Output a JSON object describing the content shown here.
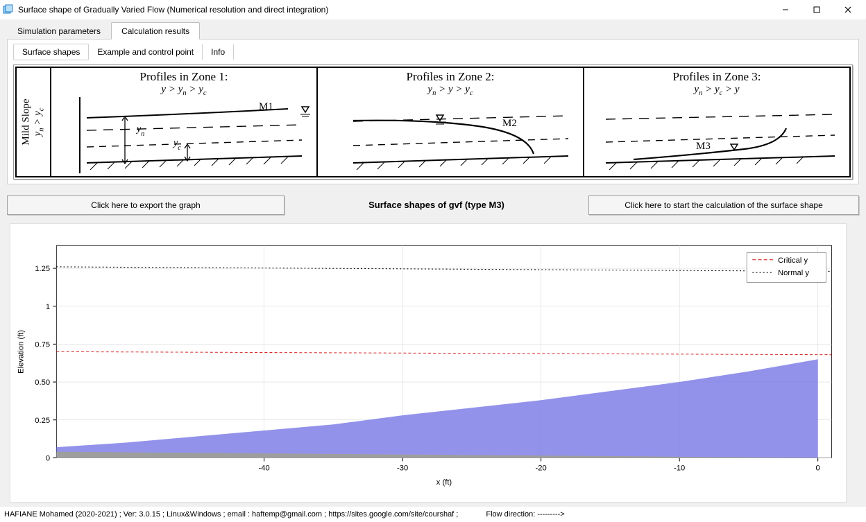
{
  "window": {
    "title": "Surface shape of Gradually Varied Flow (Numerical resolution and direct integration)"
  },
  "main_tabs": [
    {
      "label": "Simulation parameters",
      "active": false
    },
    {
      "label": "Calculation results",
      "active": true
    }
  ],
  "sub_tabs": [
    {
      "label": "Surface shapes",
      "active": true
    },
    {
      "label": "Example and control point",
      "active": false
    },
    {
      "label": "Info",
      "active": false
    }
  ],
  "profiles": {
    "side_label_line1": "Mild Slope",
    "side_label_line2": "yₙ > y₍ c₎",
    "cells": [
      {
        "title": "Profiles in Zone 1:",
        "cond": "y > yₙ > y꜀",
        "curve_label": "M1"
      },
      {
        "title": "Profiles in Zone 2:",
        "cond": "yₙ > y > y꜀",
        "curve_label": "M2"
      },
      {
        "title": "Profiles in Zone 3:",
        "cond": "yₙ > y꜀ > y",
        "curve_label": "M3"
      }
    ]
  },
  "midbar": {
    "export_button": "Click here to export the graph",
    "caption": "Surface shapes of gvf (type M3)",
    "calc_button": "Click here to start the calculation of the surface shape"
  },
  "chart_data": {
    "type": "area",
    "title": "",
    "xlabel": "x (ft)",
    "ylabel": "Elevation (ft)",
    "xlim": [
      -55,
      1
    ],
    "ylim": [
      0,
      1.4
    ],
    "x_ticks": [
      -40,
      -30,
      -20,
      -10,
      0
    ],
    "y_ticks": [
      0,
      0.25,
      0.5,
      0.75,
      1.0,
      1.25
    ],
    "legend": [
      {
        "name": "Critical y",
        "style": "dashed",
        "color": "#d42a2a"
      },
      {
        "name": "Normal y",
        "style": "dotted",
        "color": "#000000"
      }
    ],
    "reference_lines": {
      "critical_y": 0.7,
      "normal_y_left": 1.26,
      "normal_y_right": 1.23
    },
    "series": [
      {
        "name": "Water surface (M3 profile)",
        "x": [
          -55,
          -50,
          -45,
          -40,
          -35,
          -30,
          -25,
          -20,
          -15,
          -10,
          -5,
          0
        ],
        "y_top": [
          0.07,
          0.1,
          0.14,
          0.18,
          0.22,
          0.28,
          0.33,
          0.38,
          0.44,
          0.5,
          0.57,
          0.65
        ],
        "y_bot": [
          0.0,
          0.0,
          0.0,
          0.0,
          0.0,
          0.0,
          0.0,
          0.0,
          0.0,
          0.0,
          0.0,
          0.0
        ]
      },
      {
        "name": "Channel bed",
        "x": [
          -55,
          -50,
          -45,
          -40,
          -35,
          -30,
          -25,
          -20,
          -15,
          -10,
          -5,
          0
        ],
        "y_top": [
          0.04,
          0.036,
          0.033,
          0.029,
          0.025,
          0.022,
          0.018,
          0.015,
          0.011,
          0.007,
          0.004,
          0.0
        ],
        "y_bot": [
          0.0,
          0.0,
          0.0,
          0.0,
          0.0,
          0.0,
          0.0,
          0.0,
          0.0,
          0.0,
          0.0,
          0.0
        ]
      }
    ]
  },
  "footer": {
    "credit": "HAFIANE Mohamed (2020-2021) ; Ver: 3.0.15 ; Linux&Windows ; email : haftemp@gmail.com ; https://sites.google.com/site/courshaf     ;",
    "flow_label": "Flow direction: --------->"
  }
}
